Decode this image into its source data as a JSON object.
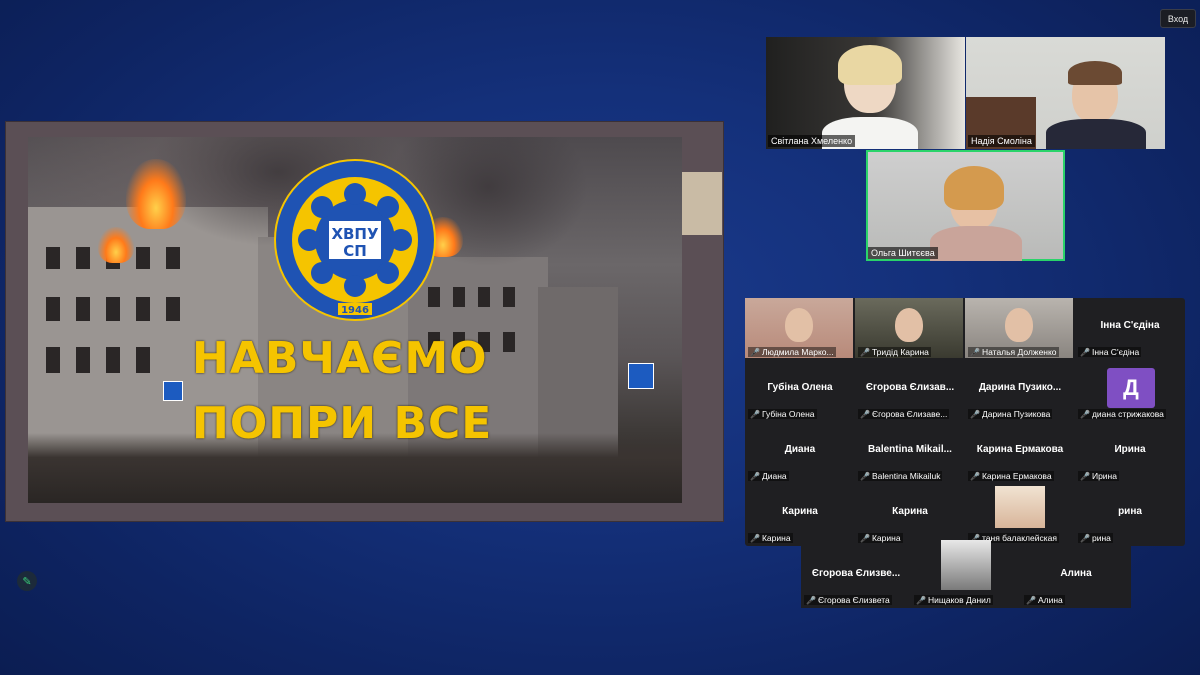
{
  "window": {
    "signin_label": "Вход"
  },
  "slide": {
    "emblem_text": "ХВПУ СП",
    "emblem_ring": "ДЕРЖАВНИЙ ПРОФЕСІЙНО-ТЕХНІЧНИЙ НАВЧАЛЬНИЙ ЗАКЛАД «ХАРКІВСЬКЕ ВИЩЕ ПРОФЕСІЙНЕ УЧИЛИЩЕ СФЕРИ ПОСЛУГ»",
    "emblem_year": "1946",
    "line1": "НАВЧАЄМО",
    "line2": "ПОПРИ ВСЕ"
  },
  "speakers": [
    {
      "name": "Світлана Хмеленко"
    },
    {
      "name": "Надія Смоліна"
    },
    {
      "name": "Ольга Шитєєва"
    }
  ],
  "gallery": [
    {
      "title": "",
      "label": "Людмила Марко...",
      "photo": true
    },
    {
      "title": "",
      "label": "Тридід Карина",
      "photo": true
    },
    {
      "title": "",
      "label": "Наталья Долженко",
      "photo": true
    },
    {
      "title": "Інна С'єдіна",
      "label": "Інна С'єдіна"
    },
    {
      "title": "Губіна Олена",
      "label": "Губіна Олена"
    },
    {
      "title": "Єгорова Єлизав...",
      "label": "Єгорова Єлизаве..."
    },
    {
      "title": "Дарина  Пузико...",
      "label": "Дарина Пузикова"
    },
    {
      "title": "",
      "label": "диана стрижакова",
      "avatar": "Д"
    },
    {
      "title": "Диана",
      "label": "Диана"
    },
    {
      "title": "Balentina  Mikail...",
      "label": "Balentina Mikailuk"
    },
    {
      "title": "Карина Ермакова",
      "label": "Карина Ермакова"
    },
    {
      "title": "Ирина",
      "label": "Ирина"
    },
    {
      "title": "Карина",
      "label": "Карина"
    },
    {
      "title": "Карина",
      "label": "Карина"
    },
    {
      "title": "",
      "label": "таня балаклейская",
      "photo": true
    },
    {
      "title": "рина",
      "label": "рина"
    },
    {
      "title": "Єгорова Єлизве...",
      "label": "Єгорова Єлизвета"
    },
    {
      "title": "",
      "label": "Нищаков Данил",
      "photo": true
    },
    {
      "title": "Алина",
      "label": "Алина"
    }
  ],
  "colors": {
    "background": "#14307a",
    "slogan": "#f5c400",
    "active_speaker": "#2ad36a",
    "avatar": "#7f4fc3",
    "mic_muted": "#e03a3a"
  },
  "icons": {
    "mic_muted": "mic-muted-icon",
    "annotate": "pencil-icon"
  }
}
